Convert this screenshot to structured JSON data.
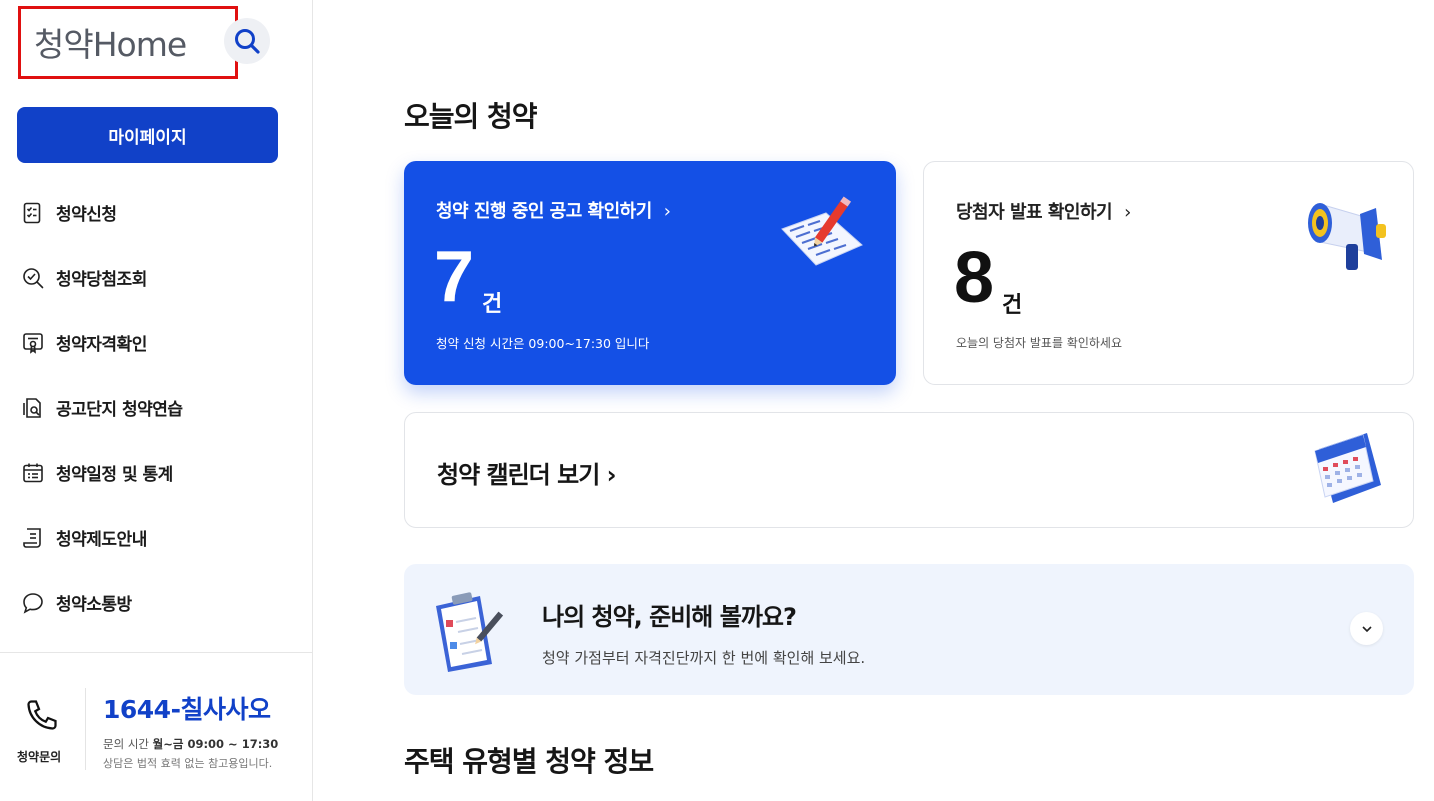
{
  "brand": {
    "logo_text": "청약Home",
    "accent_color": "#1141c8"
  },
  "sidebar": {
    "mypage_label": "마이페이지",
    "items": [
      {
        "label": "청약신청",
        "icon": "checklist-icon"
      },
      {
        "label": "청약당첨조회",
        "icon": "search-check-icon"
      },
      {
        "label": "청약자격확인",
        "icon": "certificate-icon"
      },
      {
        "label": "공고단지 청약연습",
        "icon": "practice-document-icon"
      },
      {
        "label": "청약일정 및 통계",
        "icon": "calendar-list-icon"
      },
      {
        "label": "청약제도안내",
        "icon": "guide-scroll-icon"
      },
      {
        "label": "청약소통방",
        "icon": "chat-bubble-icon"
      }
    ],
    "contact": {
      "label": "청약문의",
      "number": "1644-칠사사오",
      "hours_prefix": "문의 시간 ",
      "hours_value": "월~금 09:00 ~ 17:30",
      "note": "상담은 법적 효력 없는 참고용입니다."
    }
  },
  "main": {
    "today_title": "오늘의 청약",
    "ongoing": {
      "title": "청약 진행 중인 공고 확인하기",
      "count": "7",
      "unit": "건",
      "sub": "청약 신청 시간은 09:00~17:30 입니다"
    },
    "winners": {
      "title": "당첨자 발표 확인하기",
      "count": "8",
      "unit": "건",
      "sub": "오늘의 당첨자 발표를 확인하세요"
    },
    "calendar": {
      "label": "청약 캘린더 보기"
    },
    "prep": {
      "title": "나의 청약, 준비해 볼까요?",
      "sub": "청약 가점부터 자격진단까지 한 번에 확인해 보세요."
    },
    "housing_title": "주택 유형별 청약 정보"
  }
}
